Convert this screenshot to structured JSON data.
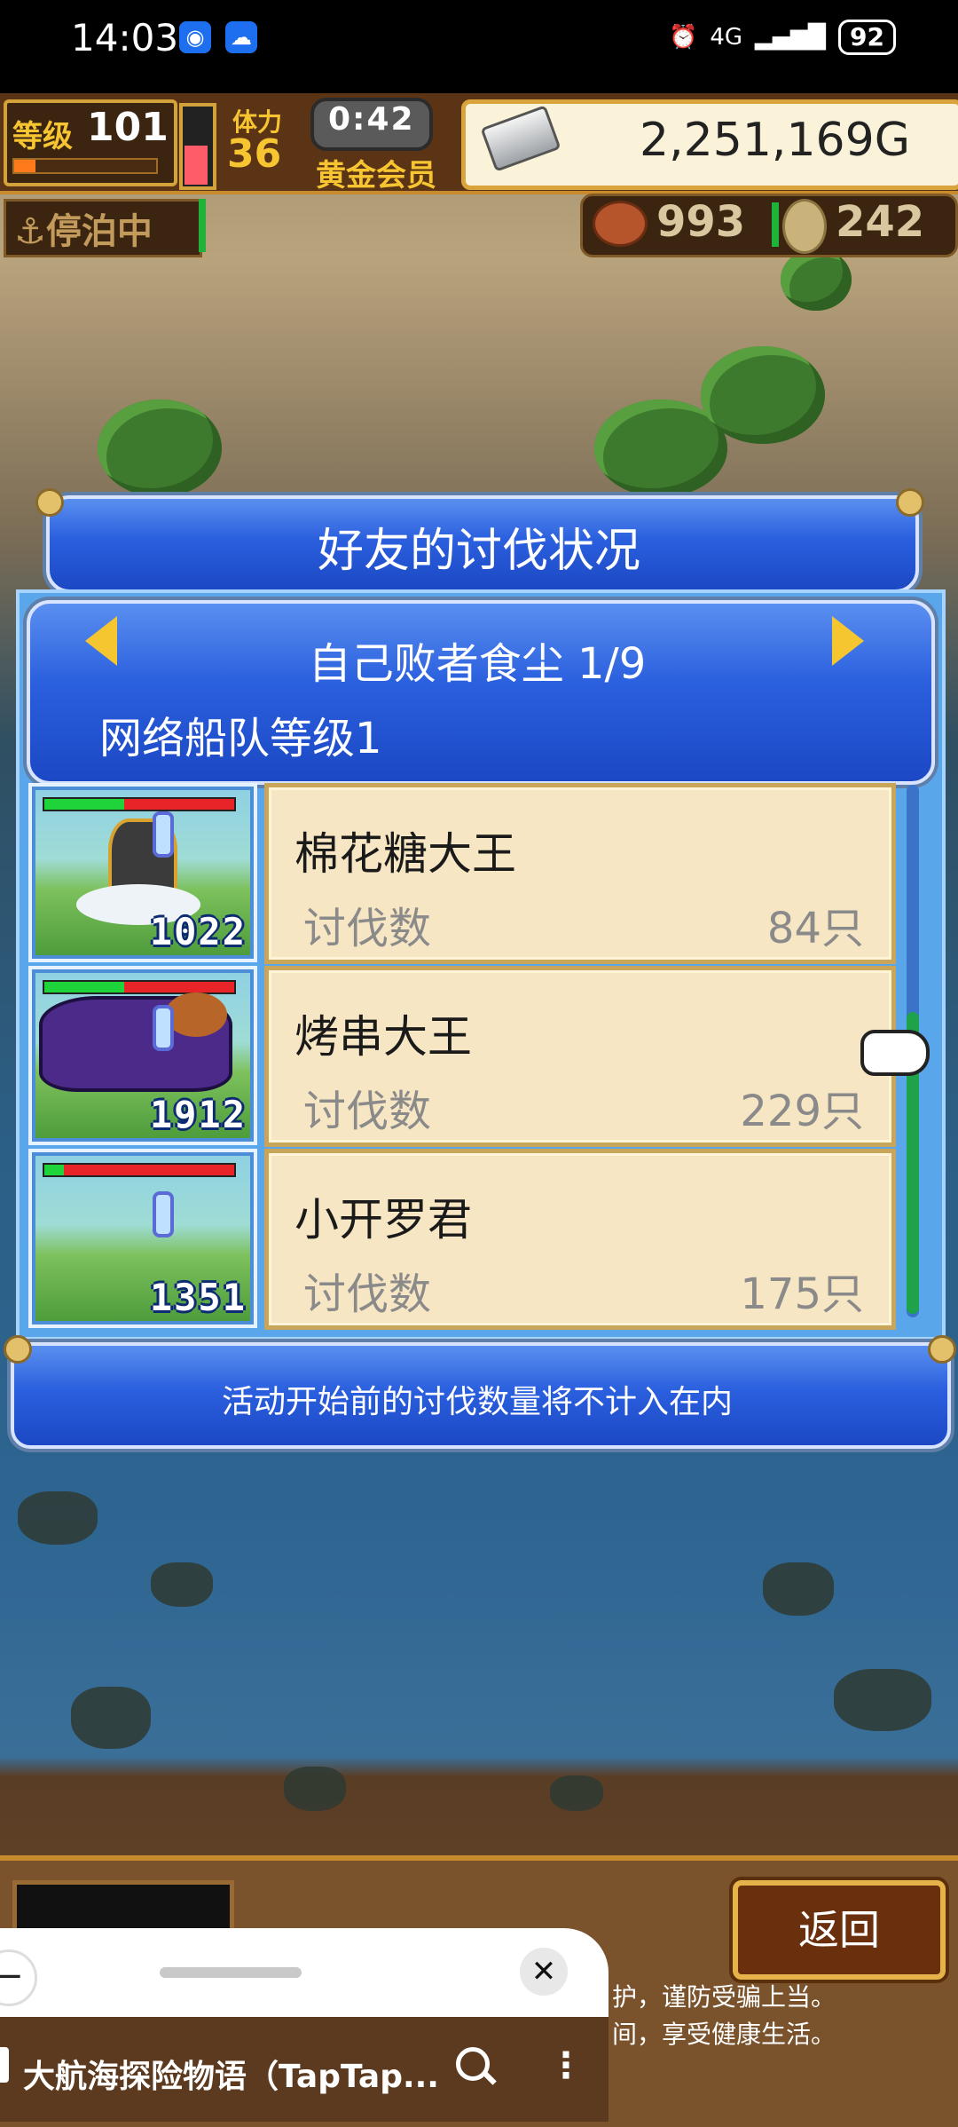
{
  "status_bar": {
    "time": "14:03",
    "network": "4G",
    "battery": "92"
  },
  "hud": {
    "level_label": "等级",
    "level_value": "101",
    "stamina_label": "体力",
    "stamina_value": "36",
    "timer": "0:42",
    "member_label": "黄金会员",
    "money": "2,251,169G",
    "anchor_status": "停泊中",
    "food": "993",
    "coins": "242"
  },
  "dialog": {
    "title": "好友的讨伐状况",
    "page_title": "自己败者食尘 1/9",
    "fleet_level": "网络船队等级1",
    "rows": [
      {
        "name": "棉花糖大王",
        "label": "讨伐数",
        "count": "84只",
        "power": "1022"
      },
      {
        "name": "烤串大王",
        "label": "讨伐数",
        "count": "229只",
        "power": "1912"
      },
      {
        "name": "小开罗君",
        "label": "讨伐数",
        "count": "175只",
        "power": "1351"
      }
    ],
    "notice": "活动开始前的讨伐数量将不计入在内"
  },
  "bottom": {
    "back_label": "返回",
    "warning_line1": "护，谨防受骗上当。",
    "warning_line2": "间，享受健康生活。"
  },
  "float_window": {
    "minus_label": "−",
    "close_label": "✕",
    "title": "大航海探险物语（TapTap...",
    "more_label": "⋮"
  },
  "colors": {
    "dialog_blue": "#2a5fde",
    "card_cream": "#f7e6c3",
    "gold": "#f5c62f",
    "hp_red": "#e82428",
    "hp_green": "#1fd43a"
  }
}
